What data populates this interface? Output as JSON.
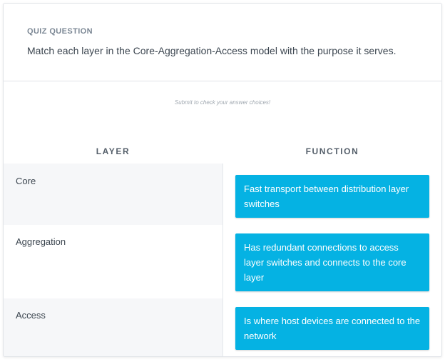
{
  "quiz": {
    "eyebrow": "QUIZ QUESTION",
    "prompt": "Match each layer in the Core-Aggregation-Access model with the purpose it serves.",
    "hint": "Submit to check your answer choices!"
  },
  "table": {
    "headers": {
      "layer": "LAYER",
      "function": "FUNCTION"
    },
    "rows": [
      {
        "layer": "Core",
        "function": "Fast transport between distribution layer switches"
      },
      {
        "layer": "Aggregation",
        "function": "Has redundant connections to access layer switches and connects to the core layer"
      },
      {
        "layer": "Access",
        "function": "Is where host devices are connected to the network"
      }
    ]
  },
  "colors": {
    "answer_bg": "#05b2e3",
    "row_shade": "#f6f7f9",
    "text": "#3c4650"
  }
}
